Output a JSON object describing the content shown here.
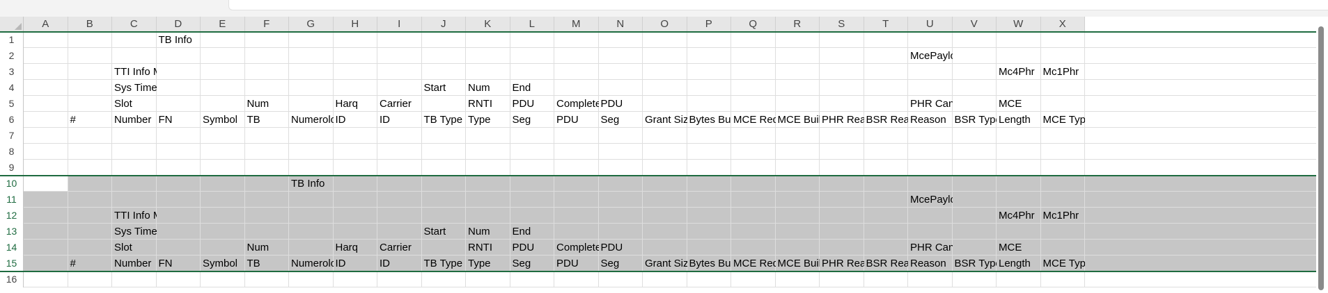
{
  "columns": [
    "A",
    "B",
    "C",
    "D",
    "E",
    "F",
    "G",
    "H",
    "I",
    "J",
    "K",
    "L",
    "M",
    "N",
    "O",
    "P",
    "Q",
    "R",
    "S",
    "T",
    "U",
    "V",
    "W",
    "X"
  ],
  "rows": [
    "1",
    "2",
    "3",
    "4",
    "5",
    "6",
    "7",
    "8",
    "9",
    "10",
    "11",
    "12",
    "13",
    "14",
    "15",
    "16"
  ],
  "selection": {
    "first_row": "10",
    "last_row": "15"
  },
  "cells": [
    {
      "row": "1",
      "col": "D",
      "text": "TB Info"
    },
    {
      "row": "2",
      "col": "U",
      "text": "McePayload"
    },
    {
      "row": "3",
      "col": "C",
      "text": "TTI Info Me"
    },
    {
      "row": "3",
      "col": "W",
      "text": "Mc4Phr"
    },
    {
      "row": "3",
      "col": "X",
      "text": "Mc1Phr"
    },
    {
      "row": "4",
      "col": "C",
      "text": "Sys Time"
    },
    {
      "row": "4",
      "col": "J",
      "text": "Start"
    },
    {
      "row": "4",
      "col": "K",
      "text": "Num"
    },
    {
      "row": "4",
      "col": "L",
      "text": "End"
    },
    {
      "row": "5",
      "col": "C",
      "text": "Slot"
    },
    {
      "row": "5",
      "col": "F",
      "text": "Num"
    },
    {
      "row": "5",
      "col": "H",
      "text": "Harq"
    },
    {
      "row": "5",
      "col": "I",
      "text": "Carrier"
    },
    {
      "row": "5",
      "col": "K",
      "text": "RNTI"
    },
    {
      "row": "5",
      "col": "L",
      "text": "PDU"
    },
    {
      "row": "5",
      "col": "M",
      "text": "Complete"
    },
    {
      "row": "5",
      "col": "N",
      "text": "PDU"
    },
    {
      "row": "5",
      "col": "U",
      "text": "PHR Canc"
    },
    {
      "row": "5",
      "col": "W",
      "text": "MCE"
    },
    {
      "row": "6",
      "col": "B",
      "text": "#"
    },
    {
      "row": "6",
      "col": "C",
      "text": "Number"
    },
    {
      "row": "6",
      "col": "D",
      "text": "FN"
    },
    {
      "row": "6",
      "col": "E",
      "text": "Symbol"
    },
    {
      "row": "6",
      "col": "F",
      "text": "TB"
    },
    {
      "row": "6",
      "col": "G",
      "text": "Numerolo"
    },
    {
      "row": "6",
      "col": "H",
      "text": "ID"
    },
    {
      "row": "6",
      "col": "I",
      "text": "ID"
    },
    {
      "row": "6",
      "col": "J",
      "text": "TB Type"
    },
    {
      "row": "6",
      "col": "K",
      "text": "Type"
    },
    {
      "row": "6",
      "col": "L",
      "text": "Seg"
    },
    {
      "row": "6",
      "col": "M",
      "text": "PDU"
    },
    {
      "row": "6",
      "col": "N",
      "text": "Seg"
    },
    {
      "row": "6",
      "col": "O",
      "text": "Grant Size"
    },
    {
      "row": "6",
      "col": "P",
      "text": "Bytes Built"
    },
    {
      "row": "6",
      "col": "Q",
      "text": "MCE Req E"
    },
    {
      "row": "6",
      "col": "R",
      "text": "MCE Built"
    },
    {
      "row": "6",
      "col": "S",
      "text": "PHR Reas"
    },
    {
      "row": "6",
      "col": "T",
      "text": "BSR Reaso"
    },
    {
      "row": "6",
      "col": "U",
      "text": "Reason"
    },
    {
      "row": "6",
      "col": "V",
      "text": "BSR Type"
    },
    {
      "row": "6",
      "col": "W",
      "text": "Length"
    },
    {
      "row": "6",
      "col": "X",
      "text": "MCE Type"
    },
    {
      "row": "10",
      "col": "G",
      "text": "TB Info"
    },
    {
      "row": "11",
      "col": "U",
      "text": "McePayload"
    },
    {
      "row": "12",
      "col": "C",
      "text": "TTI Info Me"
    },
    {
      "row": "12",
      "col": "W",
      "text": "Mc4Phr"
    },
    {
      "row": "12",
      "col": "X",
      "text": "Mc1Phr"
    },
    {
      "row": "13",
      "col": "C",
      "text": "Sys Time"
    },
    {
      "row": "13",
      "col": "J",
      "text": "Start"
    },
    {
      "row": "13",
      "col": "K",
      "text": "Num"
    },
    {
      "row": "13",
      "col": "L",
      "text": "End"
    },
    {
      "row": "14",
      "col": "C",
      "text": "Slot"
    },
    {
      "row": "14",
      "col": "F",
      "text": "Num"
    },
    {
      "row": "14",
      "col": "H",
      "text": "Harq"
    },
    {
      "row": "14",
      "col": "I",
      "text": "Carrier"
    },
    {
      "row": "14",
      "col": "K",
      "text": "RNTI"
    },
    {
      "row": "14",
      "col": "L",
      "text": "PDU"
    },
    {
      "row": "14",
      "col": "M",
      "text": "Complete"
    },
    {
      "row": "14",
      "col": "N",
      "text": "PDU"
    },
    {
      "row": "14",
      "col": "U",
      "text": "PHR Canc"
    },
    {
      "row": "14",
      "col": "W",
      "text": "MCE"
    },
    {
      "row": "15",
      "col": "B",
      "text": "#"
    },
    {
      "row": "15",
      "col": "C",
      "text": "Number"
    },
    {
      "row": "15",
      "col": "D",
      "text": "FN"
    },
    {
      "row": "15",
      "col": "E",
      "text": "Symbol"
    },
    {
      "row": "15",
      "col": "F",
      "text": "TB"
    },
    {
      "row": "15",
      "col": "G",
      "text": "Numerolo"
    },
    {
      "row": "15",
      "col": "H",
      "text": "ID"
    },
    {
      "row": "15",
      "col": "I",
      "text": "ID"
    },
    {
      "row": "15",
      "col": "J",
      "text": "TB Type"
    },
    {
      "row": "15",
      "col": "K",
      "text": "Type"
    },
    {
      "row": "15",
      "col": "L",
      "text": "Seg"
    },
    {
      "row": "15",
      "col": "M",
      "text": "PDU"
    },
    {
      "row": "15",
      "col": "N",
      "text": "Seg"
    },
    {
      "row": "15",
      "col": "O",
      "text": "Grant Size"
    },
    {
      "row": "15",
      "col": "P",
      "text": "Bytes Built"
    },
    {
      "row": "15",
      "col": "Q",
      "text": "MCE Req E"
    },
    {
      "row": "15",
      "col": "R",
      "text": "MCE Built"
    },
    {
      "row": "15",
      "col": "S",
      "text": "PHR Reas"
    },
    {
      "row": "15",
      "col": "T",
      "text": "BSR Reaso"
    },
    {
      "row": "15",
      "col": "U",
      "text": "Reason"
    },
    {
      "row": "15",
      "col": "V",
      "text": "BSR Type"
    },
    {
      "row": "15",
      "col": "W",
      "text": "Length"
    },
    {
      "row": "15",
      "col": "X",
      "text": "MCE Type"
    }
  ]
}
